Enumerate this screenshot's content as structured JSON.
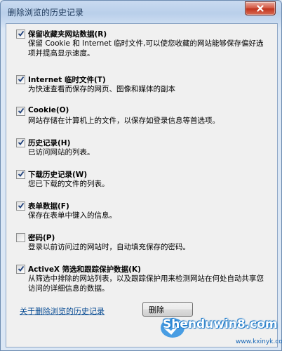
{
  "window": {
    "title": "删除浏览的历史记录"
  },
  "items": [
    {
      "label": "保留收藏夹网站数据(R)",
      "desc": "保留 Cookie 和 Internet 临时文件,可以使您收藏的网站能够保存偏好选项并提高显示速度。",
      "checked": true
    },
    {
      "label": "Internet 临时文件(T)",
      "desc": "为快速查看而保存的网页、图像和媒体的副本",
      "checked": true
    },
    {
      "label": "Cookie(O)",
      "desc": "网站存储在计算机上的文件，以保存如登录信息等首选项。",
      "checked": true
    },
    {
      "label": "历史记录(H)",
      "desc": "已访问网站的列表。",
      "checked": true
    },
    {
      "label": "下载历史记录(W)",
      "desc": "您已下载的文件的列表。",
      "checked": true
    },
    {
      "label": "表单数据(F)",
      "desc": "保存在表单中键入的信息。",
      "checked": true
    },
    {
      "label": "密码(P)",
      "desc": "登录以前访问过的网站时，自动填充保存的密码。",
      "checked": false
    },
    {
      "label": "ActiveX 筛选和跟踪保护数据(K)",
      "desc": "从筛选中排除的网站列表，以及跟踪保护用来检测网站在何处自动共享您访问的详细信息的数据。",
      "checked": true
    }
  ],
  "footer": {
    "link": "关于删除浏览的历史记录",
    "delete_button": "删除"
  },
  "watermark": {
    "text": "Shenduwin8.com",
    "url": "www.kxinyk.com"
  },
  "icons": {
    "close": "close-icon",
    "check": "checkmark-icon"
  }
}
